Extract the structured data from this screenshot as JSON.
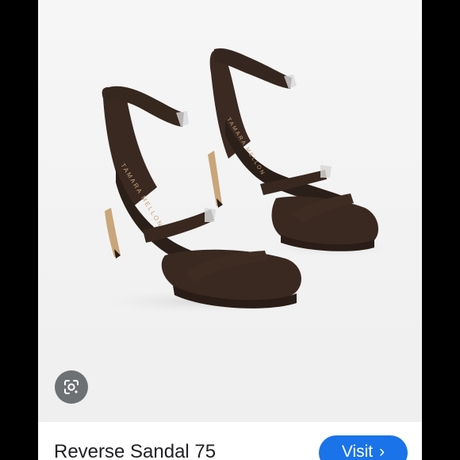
{
  "product": {
    "title": "Reverse Sandal 75",
    "brand_imprint": "TAMARA MELLON",
    "image_subject": "sandal-photo"
  },
  "actions": {
    "visit_label": "Visit",
    "visit_chevron": "›",
    "lens_icon": "google-lens-icon"
  },
  "colors": {
    "accent": "#1a73e8",
    "suede": "#3b2a22",
    "heel": "#c9a57a"
  }
}
